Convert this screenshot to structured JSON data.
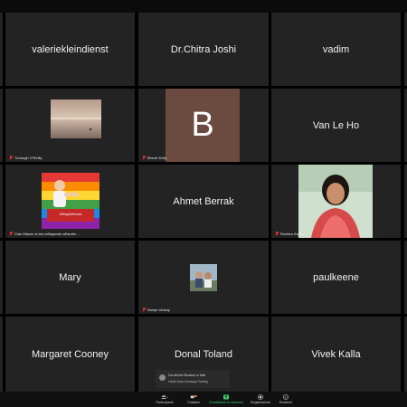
{
  "tiles": [
    {
      "display": "valeriekleindienst",
      "label": ""
    },
    {
      "display": "Dr.Chitra Joshi",
      "label": ""
    },
    {
      "display": "vadim",
      "label": ""
    },
    {
      "display": "",
      "label": "Turlough O'Reilly"
    },
    {
      "display": "B",
      "label": "Bernie Kelly"
    },
    {
      "display": "Van Le Ho",
      "label": ""
    },
    {
      "display": "",
      "label": "Cian Mason si sta collegando all'audio ..."
    },
    {
      "display": "Ahmet Berrak",
      "label": ""
    },
    {
      "display": "",
      "label": "Ruchira Kadira"
    },
    {
      "display": "Mary",
      "label": ""
    },
    {
      "display": "",
      "label": "Nuriye Ulusoy"
    },
    {
      "display": "paulkeene",
      "label": ""
    },
    {
      "display": "Margaret Cooney",
      "label": ""
    },
    {
      "display": "Donal Toland",
      "label": ""
    },
    {
      "display": "Vivek Kalla",
      "label": ""
    }
  ],
  "pride_caption": "#StayAtHome",
  "toolbar": {
    "participants_label": "Partecipanti",
    "participants_count": "118",
    "chat_label": "Chattare",
    "chat_badge": "42",
    "share_label": "Condividere lo schermo",
    "record_label": "Registrazione",
    "reactions_label": "Reazioni"
  },
  "chat_toast": {
    "from": "Da Ahmet Bozkurt a tutti",
    "message": "Hello from Amasya Turkey"
  },
  "colors": {
    "tile_bg": "#232323",
    "share_green": "#3fd16b",
    "bernie_bg": "#6b4a40"
  }
}
